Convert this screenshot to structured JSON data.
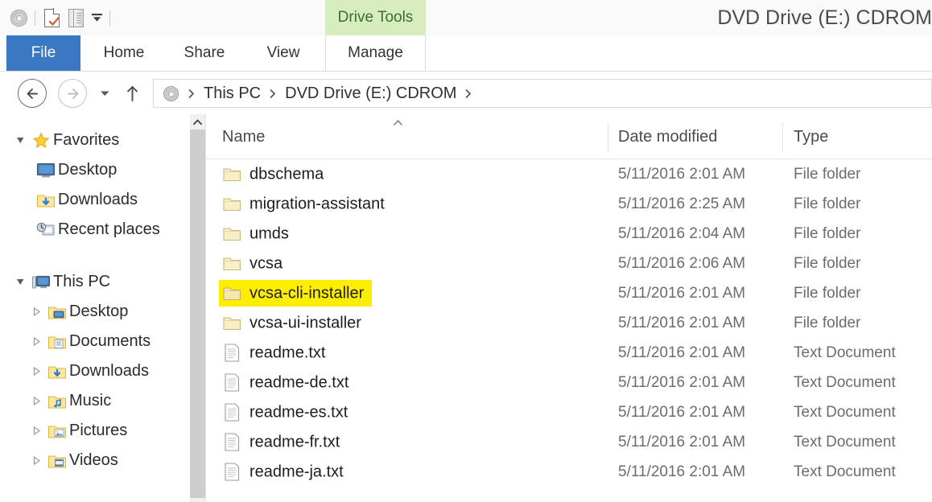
{
  "window": {
    "title": "DVD Drive (E:) CDROM",
    "quick_access": [
      {
        "name": "disc-icon",
        "label": "DVD Drive"
      },
      {
        "name": "new-item-icon",
        "label": "New"
      },
      {
        "name": "properties-icon",
        "label": "Properties"
      },
      {
        "name": "chevron-down-icon",
        "label": "Customize Quick Access Toolbar"
      }
    ]
  },
  "ribbon": {
    "contextual_tab": "Drive Tools",
    "contextual_tab_color": "#d6edc0",
    "file_tab_color": "#3a79c2",
    "tabs": [
      {
        "label": "File",
        "active": true
      },
      {
        "label": "Home",
        "active": false
      },
      {
        "label": "Share",
        "active": false
      },
      {
        "label": "View",
        "active": false
      },
      {
        "label": "Manage",
        "active": false
      }
    ]
  },
  "address_bar": {
    "back_label": "Back",
    "forward_label": "Forward",
    "recent_label": "Recent locations",
    "up_label": "Up",
    "breadcrumb": [
      "This PC",
      "DVD Drive (E:) CDROM"
    ]
  },
  "nav_pane": {
    "groups": [
      {
        "header": {
          "label": "Favorites",
          "icon": "star-icon",
          "expanded": true
        },
        "items": [
          {
            "label": "Desktop",
            "icon": "desktop-icon",
            "expandable": false
          },
          {
            "label": "Downloads",
            "icon": "downloads-folder-icon",
            "expandable": false
          },
          {
            "label": "Recent places",
            "icon": "recent-places-icon",
            "expandable": false
          }
        ]
      },
      {
        "header": {
          "label": "This PC",
          "icon": "computer-icon",
          "expanded": true
        },
        "items": [
          {
            "label": "Desktop",
            "icon": "desktop-folder-icon",
            "expandable": true
          },
          {
            "label": "Documents",
            "icon": "documents-folder-icon",
            "expandable": true
          },
          {
            "label": "Downloads",
            "icon": "downloads-folder-icon",
            "expandable": true
          },
          {
            "label": "Music",
            "icon": "music-folder-icon",
            "expandable": true
          },
          {
            "label": "Pictures",
            "icon": "pictures-folder-icon",
            "expandable": true
          },
          {
            "label": "Videos",
            "icon": "videos-folder-icon",
            "expandable": true
          }
        ]
      }
    ],
    "scrollbar": {
      "visible": true,
      "up_arrow": "chevron-up-icon"
    }
  },
  "file_list": {
    "columns": [
      "Name",
      "Date modified",
      "Type"
    ],
    "sort_column": "Name",
    "sort_direction": "ascending",
    "highlight_color": "#fdee00",
    "rows": [
      {
        "name": "dbschema",
        "date": "5/11/2016 2:01 AM",
        "type": "File folder",
        "icon": "folder-icon",
        "highlighted": false
      },
      {
        "name": "migration-assistant",
        "date": "5/11/2016 2:25 AM",
        "type": "File folder",
        "icon": "folder-icon",
        "highlighted": false
      },
      {
        "name": "umds",
        "date": "5/11/2016 2:04 AM",
        "type": "File folder",
        "icon": "folder-icon",
        "highlighted": false
      },
      {
        "name": "vcsa",
        "date": "5/11/2016 2:06 AM",
        "type": "File folder",
        "icon": "folder-icon",
        "highlighted": false
      },
      {
        "name": "vcsa-cli-installer",
        "date": "5/11/2016 2:01 AM",
        "type": "File folder",
        "icon": "folder-icon",
        "highlighted": true
      },
      {
        "name": "vcsa-ui-installer",
        "date": "5/11/2016 2:01 AM",
        "type": "File folder",
        "icon": "folder-icon",
        "highlighted": false
      },
      {
        "name": "readme.txt",
        "date": "5/11/2016 2:01 AM",
        "type": "Text Document",
        "icon": "text-file-icon",
        "highlighted": false
      },
      {
        "name": "readme-de.txt",
        "date": "5/11/2016 2:01 AM",
        "type": "Text Document",
        "icon": "text-file-icon",
        "highlighted": false
      },
      {
        "name": "readme-es.txt",
        "date": "5/11/2016 2:01 AM",
        "type": "Text Document",
        "icon": "text-file-icon",
        "highlighted": false
      },
      {
        "name": "readme-fr.txt",
        "date": "5/11/2016 2:01 AM",
        "type": "Text Document",
        "icon": "text-file-icon",
        "highlighted": false
      },
      {
        "name": "readme-ja.txt",
        "date": "5/11/2016 2:01 AM",
        "type": "Text Document",
        "icon": "text-file-icon",
        "highlighted": false
      }
    ]
  }
}
